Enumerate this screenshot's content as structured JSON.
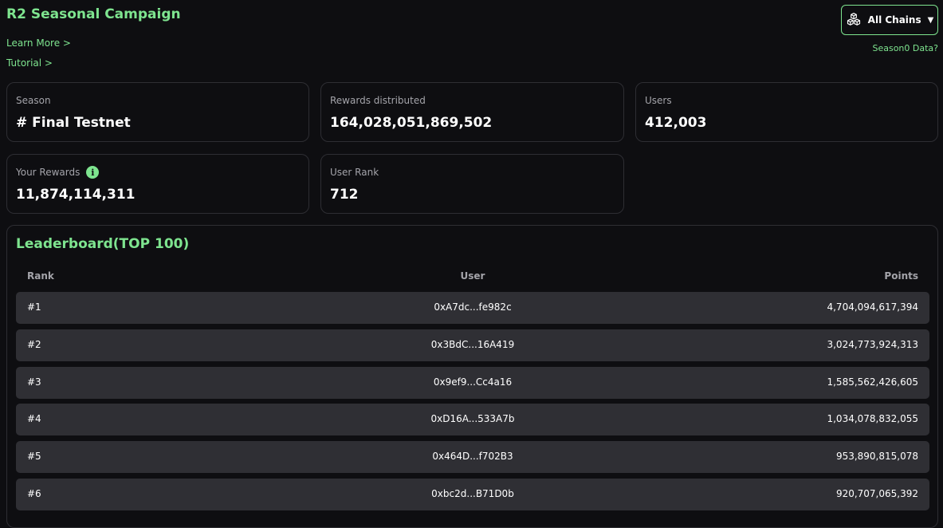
{
  "header": {
    "title": "R2 Seasonal Campaign",
    "learn_more": "Learn More >",
    "tutorial": "Tutorial >",
    "chains_label": "All Chains",
    "chains_icon": "cubes-icon",
    "season0": "Season0 Data?"
  },
  "stats": {
    "season_label": "Season",
    "season_value": "# Final Testnet",
    "rewards_label": "Rewards distributed",
    "rewards_value": "164,028,051,869,502",
    "users_label": "Users",
    "users_value": "412,003",
    "your_rewards_label": "Your Rewards",
    "your_rewards_value": "11,874,114,311",
    "rank_label": "User Rank",
    "rank_value": "712"
  },
  "leaderboard": {
    "title": "Leaderboard(TOP 100)",
    "columns": {
      "rank": "Rank",
      "user": "User",
      "points": "Points"
    },
    "rows": [
      {
        "rank": "#1",
        "user": "0xA7dc...fe982c",
        "points": "4,704,094,617,394"
      },
      {
        "rank": "#2",
        "user": "0x3BdC...16A419",
        "points": "3,024,773,924,313"
      },
      {
        "rank": "#3",
        "user": "0x9ef9...Cc4a16",
        "points": "1,585,562,426,605"
      },
      {
        "rank": "#4",
        "user": "0xD16A...533A7b",
        "points": "1,034,078,832,055"
      },
      {
        "rank": "#5",
        "user": "0x464D...f702B3",
        "points": "953,890,815,078"
      },
      {
        "rank": "#6",
        "user": "0xbc2d...B71D0b",
        "points": "920,707,065,392"
      }
    ]
  },
  "colors": {
    "accent": "#7ee48f",
    "background": "#0e0e11",
    "row_bg": "#2f2f34",
    "border": "#2e2e33"
  }
}
